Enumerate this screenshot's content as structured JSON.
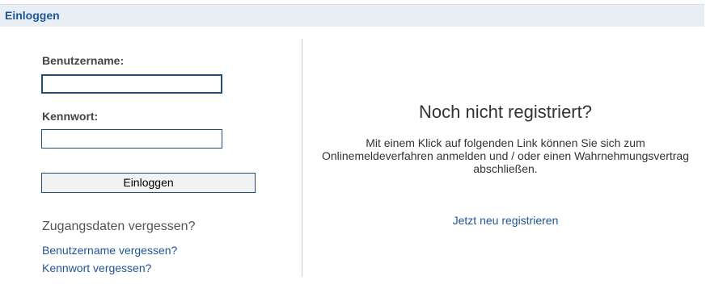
{
  "header": {
    "title": "Einloggen"
  },
  "login_form": {
    "username_label": "Benutzername:",
    "username_value": "",
    "password_label": "Kennwort:",
    "password_value": "",
    "submit_label": "Einloggen"
  },
  "forgot": {
    "heading": "Zugangsdaten vergessen?",
    "username_link": "Benutzername vergessen?",
    "password_link": "Kennwort vergessen?"
  },
  "register": {
    "heading": "Noch nicht registriert?",
    "text": "Mit einem Klick auf folgenden Link können Sie sich zum Onlinemeldeverfahren anmelden und / oder einen Wahrnehmungsvertrag abschließen.",
    "link_label": "Jetzt neu registrieren"
  },
  "colors": {
    "accent": "#1f5596",
    "header_bg": "#e8eef4",
    "input_border": "#1f4e79"
  }
}
